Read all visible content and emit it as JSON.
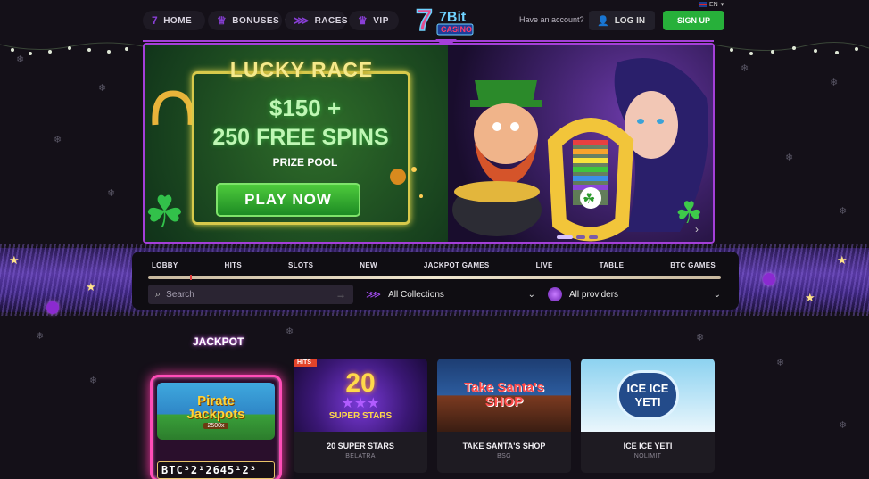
{
  "nav": {
    "home": "HOME",
    "bonuses": "BONUSES",
    "races": "RACES",
    "vip": "VIP",
    "logo_top": "7Bit",
    "logo_bottom": "CASINO",
    "lang": "EN",
    "have_account": "Have an account?",
    "login": "LOG IN",
    "signup": "SIGN UP"
  },
  "banner": {
    "title": "LUCKY RACE",
    "amount": "$150 +",
    "spins": "250 FREE SPINS",
    "pool": "PRIZE POOL",
    "cta": "PLAY NOW"
  },
  "categories": [
    "LOBBY",
    "HITS",
    "SLOTS",
    "NEW",
    "JACKPOT GAMES",
    "LIVE",
    "TABLE",
    "BTC GAMES"
  ],
  "filters": {
    "search_placeholder": "Search",
    "collections": "All Collections",
    "providers": "All providers"
  },
  "section_title": "JACKPOT",
  "jackpot_game": {
    "name_line1": "Pirate",
    "name_line2": "Jackpots",
    "multiplier": "2500x",
    "counter": "BTC³2¹2645¹2³"
  },
  "games": [
    {
      "thumb": "20",
      "thumb_sub": "SUPER STARS",
      "name": "20 SUPER STARS",
      "provider": "BELATRA",
      "badge": "HITS"
    },
    {
      "thumb": "Take Santa's SHOP",
      "thumb_sub": "",
      "name": "TAKE SANTA'S SHOP",
      "provider": "BSG",
      "badge": ""
    },
    {
      "thumb": "ICE ICE YETI",
      "thumb_sub": "",
      "name": "ICE ICE YETI",
      "provider": "NOLIMIT",
      "badge": ""
    }
  ],
  "colors": {
    "accent_purple": "#a43fd9",
    "signup_green": "#27b03a",
    "jackpot_pink": "#ff4db8"
  }
}
